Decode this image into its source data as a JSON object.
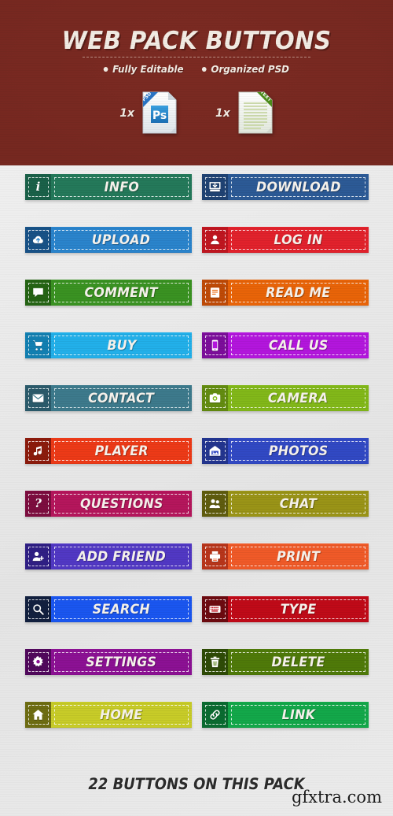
{
  "header": {
    "title": "WEB PACK BUTTONS",
    "features": [
      {
        "label": "Fully Editable"
      },
      {
        "label": "Organized PSD"
      }
    ],
    "files": [
      {
        "count": "1x",
        "type": "psd",
        "badge": "PSD",
        "glyph": "Ps"
      },
      {
        "count": "1x",
        "type": "text",
        "badge": "TEXT",
        "glyph": ""
      }
    ],
    "bg_color": "#7b2a22",
    "text_color": "#f2ece4"
  },
  "buttons": [
    {
      "label": "INFO",
      "icon": "info-icon",
      "body_color": "#24795a",
      "icon_color": "#1a6149"
    },
    {
      "label": "DOWNLOAD",
      "icon": "inbox-down-icon",
      "body_color": "#2c5a96",
      "icon_color": "#1f4273"
    },
    {
      "label": "UPLOAD",
      "icon": "cloud-up-icon",
      "body_color": "#2a84cc",
      "icon_color": "#185287"
    },
    {
      "label": "LOG IN",
      "icon": "user-icon",
      "body_color": "#e2222c",
      "icon_color": "#c01620"
    },
    {
      "label": "COMMENT",
      "icon": "speech-icon",
      "body_color": "#3a9222",
      "icon_color": "#256414"
    },
    {
      "label": "READ ME",
      "icon": "book-icon",
      "body_color": "#e96408",
      "icon_color": "#bf4a06"
    },
    {
      "label": "BUY",
      "icon": "cart-icon",
      "body_color": "#22b0ea",
      "icon_color": "#1280b2"
    },
    {
      "label": "CALL US",
      "icon": "phone-icon",
      "body_color": "#b316dd",
      "icon_color": "#7c0d9b"
    },
    {
      "label": "CONTACT",
      "icon": "envelope-icon",
      "body_color": "#3d7a8c",
      "icon_color": "#2b5b6b"
    },
    {
      "label": "CAMERA",
      "icon": "camera-icon",
      "body_color": "#82b819",
      "icon_color": "#638c10"
    },
    {
      "label": "PLAYER",
      "icon": "music-note-icon",
      "body_color": "#ed3a17",
      "icon_color": "#8c1b0c"
    },
    {
      "label": "PHOTOS",
      "icon": "photo-icon",
      "body_color": "#3149c4",
      "icon_color": "#23358f"
    },
    {
      "label": "QUESTIONS",
      "icon": "question-icon",
      "body_color": "#b5165c",
      "icon_color": "#7d0d3f"
    },
    {
      "label": "CHAT",
      "icon": "users-icon",
      "body_color": "#9a9417",
      "icon_color": "#5f5c0e"
    },
    {
      "label": "ADD FRIEND",
      "icon": "user-plus-icon",
      "body_color": "#5138c4",
      "icon_color": "#2f1f85"
    },
    {
      "label": "PRINT",
      "icon": "printer-icon",
      "body_color": "#f05a28",
      "icon_color": "#b8351a"
    },
    {
      "label": "SEARCH",
      "icon": "search-icon",
      "body_color": "#1a56f0",
      "icon_color": "#12203f"
    },
    {
      "label": "TYPE",
      "icon": "keyboard-icon",
      "body_color": "#c00a18",
      "icon_color": "#6d0a10"
    },
    {
      "label": "SETTINGS",
      "icon": "gear-icon",
      "body_color": "#8c1194",
      "icon_color": "#51085c"
    },
    {
      "label": "DELETE",
      "icon": "trash-icon",
      "body_color": "#4f7a09",
      "icon_color": "#2e4b06"
    },
    {
      "label": "HOME",
      "icon": "home-icon",
      "body_color": "#c8cc28",
      "icon_color": "#6e6d12"
    },
    {
      "label": "LINK",
      "icon": "chain-icon",
      "body_color": "#13a84a",
      "icon_color": "#0a6b30"
    }
  ],
  "footer": {
    "text": "22 BUTTONS ON THIS PACK",
    "watermark": "gfxtra.com"
  }
}
